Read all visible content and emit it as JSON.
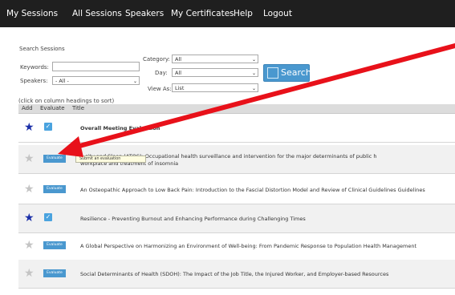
{
  "nav": {
    "items": [
      "My Sessions",
      "All Sessions",
      "Speakers",
      "My Certificates",
      "Help",
      "Logout"
    ],
    "bg_color": "#1f1f1f"
  },
  "search": {
    "heading": "Search Sessions",
    "keywords_label": "Keywords:",
    "keywords_value": "",
    "speakers_label": "Speakers:",
    "speakers_value": "- All -",
    "category_label": "Category:",
    "category_value": "All",
    "day_label": "Day:",
    "day_value": "All",
    "viewas_label": "View As:",
    "viewas_value": "List",
    "button_label": "Search",
    "accent_color": "#4a98cf"
  },
  "table": {
    "sort_hint": "(click on column headings to sort)",
    "columns": [
      "Add",
      "Evaluate",
      "Title"
    ],
    "rows": [
      {
        "starred": true,
        "evaluated": true,
        "title_line1": "Overall Meeting Evaluation",
        "title_line2": "",
        "bold": true
      },
      {
        "starred": false,
        "evaluated": false,
        "title_line1": "...sity and Sleep (ATOS): Occupational health surveillance and intervention for the major determinants of public h",
        "title_line2": "workplace and treatment of insomnia",
        "bold": false
      },
      {
        "starred": false,
        "evaluated": false,
        "title_line1": "An Osteopathic Approach to Low Back Pain: Introduction to the Fascial Distortion Model and Review of  Clinical Guidelines Guidelines",
        "title_line2": "",
        "bold": false
      },
      {
        "starred": true,
        "evaluated": true,
        "title_line1": "Resilience - Preventing Burnout and Enhancing Performance during Challenging Times",
        "title_line2": "",
        "bold": false
      },
      {
        "starred": false,
        "evaluated": false,
        "title_line1": "A Global Perspective on Harmonizing an Environment of Well-being: From Pandemic Response to Population Health Management",
        "title_line2": "",
        "bold": false
      },
      {
        "starred": false,
        "evaluated": false,
        "title_line1": "Social Determinants of Health (SDOH): The Impact of the Job Title, the Injured Worker, and Employer-based Resources",
        "title_line2": "",
        "bold": false
      }
    ],
    "evaluate_label": "Evaluate",
    "check_mark": "✓",
    "star_glyph": "★",
    "star_on_color": "#1b2fa8",
    "star_off_color": "#c4c4c4"
  },
  "tooltip": {
    "text": "Submit an evaluation"
  },
  "annotation": {
    "arrow_color": "#e8111a"
  }
}
